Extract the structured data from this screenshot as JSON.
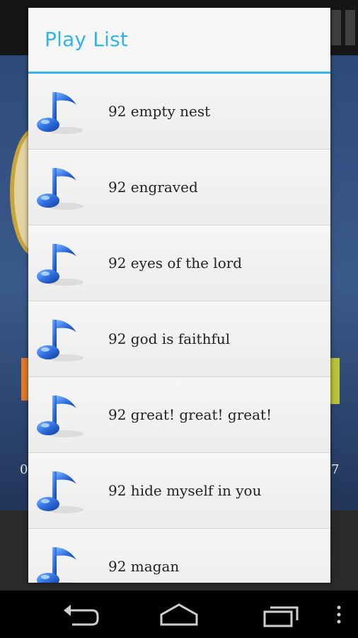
{
  "dialog": {
    "title": "Play List",
    "accent_color": "#33b5e5",
    "items": [
      {
        "label": "92 empty nest",
        "icon": "music-note-icon"
      },
      {
        "label": "92 engraved",
        "icon": "music-note-icon"
      },
      {
        "label": "92 eyes of the lord",
        "icon": "music-note-icon"
      },
      {
        "label": "92 god is faithful",
        "icon": "music-note-icon"
      },
      {
        "label": "92 great! great! great!",
        "icon": "music-note-icon"
      },
      {
        "label": "92 hide myself in you",
        "icon": "music-note-icon"
      },
      {
        "label": "92 magan",
        "icon": "music-note-icon"
      }
    ]
  },
  "background": {
    "time_left": "0",
    "time_right": "7"
  },
  "navbar": {
    "buttons": [
      "back-icon",
      "home-icon",
      "recents-icon",
      "menu-icon"
    ]
  }
}
